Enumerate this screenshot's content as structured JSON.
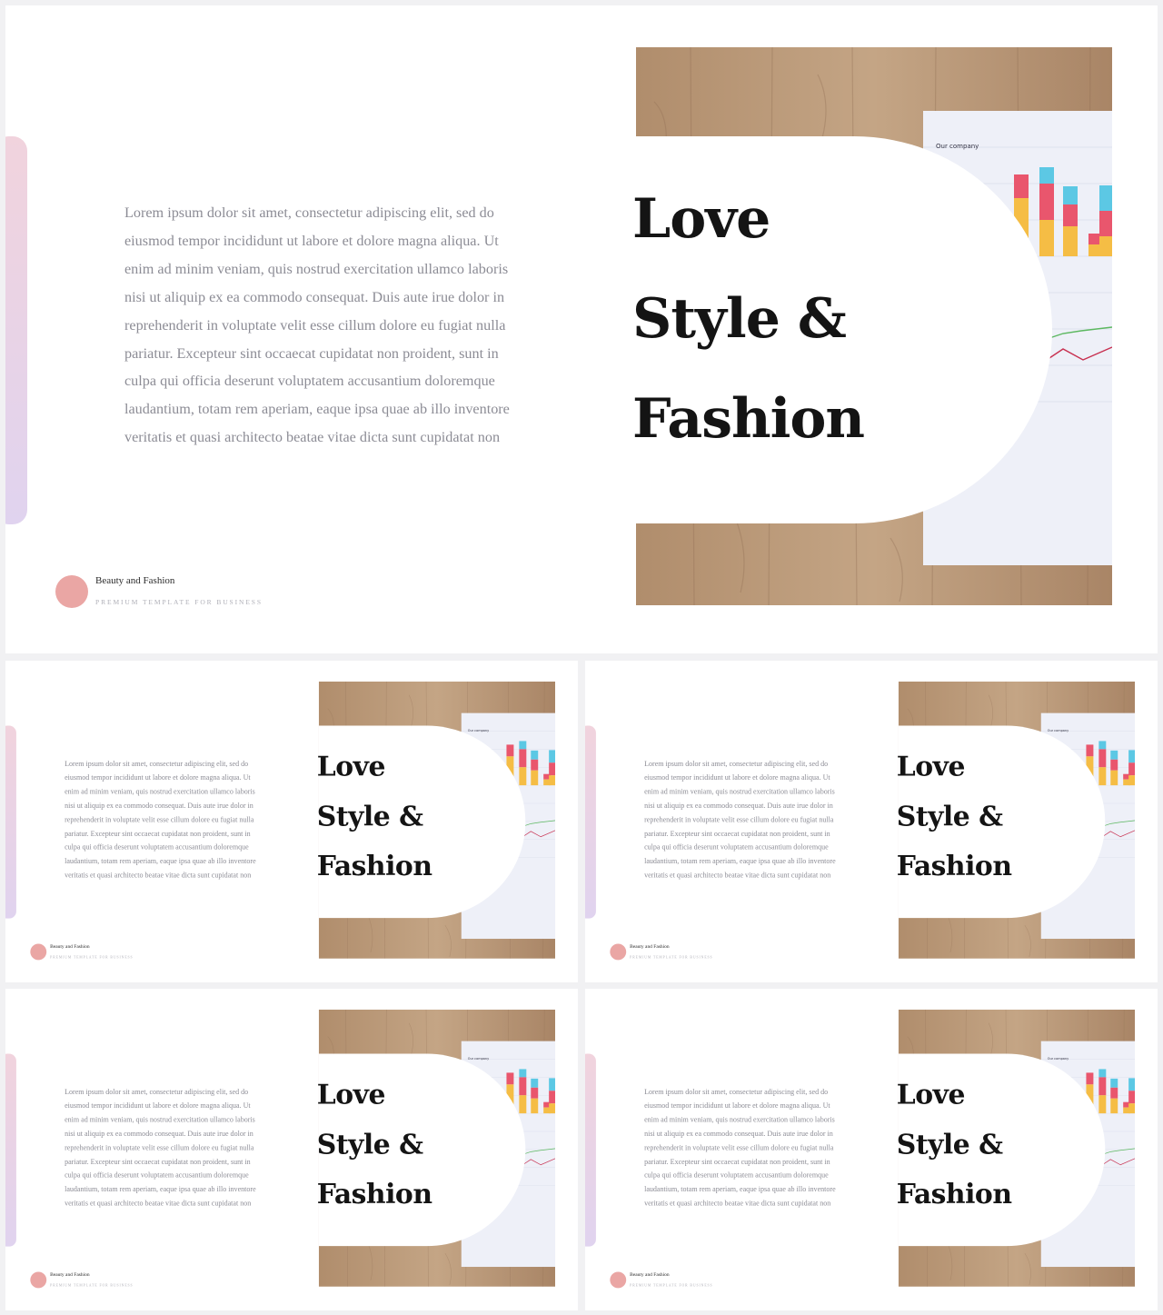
{
  "slide": {
    "headline": [
      "Love",
      "Style &",
      "Fashion"
    ],
    "body": "Lorem ipsum dolor sit amet, consectetur adipiscing elit, sed do eiusmod tempor incididunt ut labore et dolore magna aliqua. Ut enim ad minim veniam, quis nostrud exercitation ullamco laboris nisi ut aliquip ex ea commodo consequat. Duis aute irue dolor in reprehenderit in voluptate velit esse cillum dolore eu fugiat nulla pariatur. Excepteur sint occaecat cupidatat non proident, sunt in culpa qui officia deserunt voluptatem accusantium doloremque laudantium, totam rem aperiam, eaque ipsa quae ab illo inventore veritatis et quasi architecto beatae vitae dicta sunt cupidatat non",
    "brand_name": "Beauty and Fashion",
    "brand_tagline": "PREMIUM TEMPLATE FOR BUSINESS",
    "photo_caption": "Our company"
  },
  "colors": {
    "accent_pink": "#eaa6a4",
    "accent_bar_top": "#f1d3dd",
    "accent_bar_bottom": "#e0d3ef",
    "wood": "#b99a7c",
    "chart_cyan": "#5cc8e4",
    "chart_red": "#e9566d",
    "chart_yellow": "#f5bd45"
  },
  "slides": [
    "slide-large",
    "slide-thumb-1",
    "slide-thumb-2",
    "slide-thumb-3",
    "slide-thumb-4"
  ]
}
